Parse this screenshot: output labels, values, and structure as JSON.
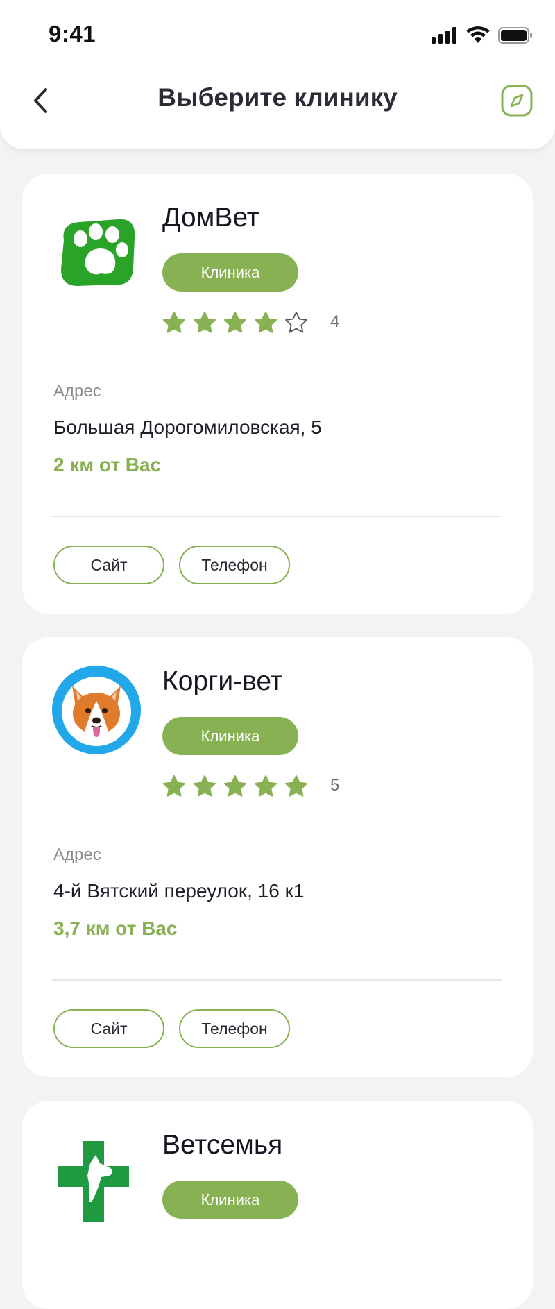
{
  "status_bar": {
    "time": "9:41"
  },
  "header": {
    "title": "Выберите клинику"
  },
  "clinics": [
    {
      "name": "ДомВет",
      "type_badge": "Клиника",
      "rating": 4,
      "rating_text": "4",
      "address_label": "Адрес",
      "address": "Большая Дорогомиловская, 5",
      "distance": "2 км от Вас",
      "site_label": "Сайт",
      "phone_label": "Телефон",
      "logo_icon": "green-paw-icon"
    },
    {
      "name": "Корги-вет",
      "type_badge": "Клиника",
      "rating": 5,
      "rating_text": "5",
      "address_label": "Адрес",
      "address": "4-й Вятский переулок, 16 к1",
      "distance": "3,7 км от Вас",
      "site_label": "Сайт",
      "phone_label": "Телефон",
      "logo_icon": "corgi-icon"
    },
    {
      "name": "Ветсемья",
      "type_badge": "Клиника",
      "logo_icon": "green-cross-dog-icon"
    }
  ],
  "colors": {
    "accent": "#87b152",
    "background": "#f3f3f5",
    "card": "#ffffff"
  }
}
